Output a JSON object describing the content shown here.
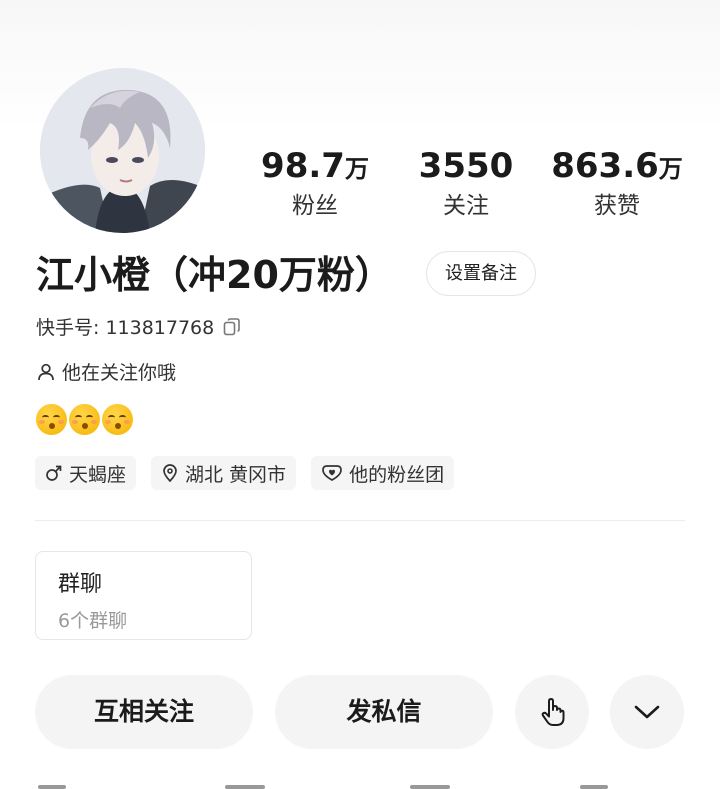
{
  "profile": {
    "name": "江小橙（冲20万粉）",
    "remark_button": "设置备注",
    "kwai_id": "快手号: 113817768",
    "follow_hint": "他在关注你哦"
  },
  "stats": {
    "fans": {
      "value": "98.7",
      "unit": "万",
      "label": "粉丝"
    },
    "following": {
      "value": "3550",
      "unit": "",
      "label": "关注"
    },
    "likes": {
      "value": "863.6",
      "unit": "万",
      "label": "获赞"
    }
  },
  "emoji": [
    "kissing-smiling-eyes",
    "kissing-smiling-eyes",
    "kissing-smiling-eyes"
  ],
  "tags": {
    "zodiac": "天蝎座",
    "location": "湖北 黄冈市",
    "fan_group": "他的粉丝团"
  },
  "group_chat": {
    "title": "群聊",
    "count": "6个群聊"
  },
  "actions": {
    "mutual_follow": "互相关注",
    "message": "发私信"
  },
  "icons": {
    "copy": "copy-icon",
    "person": "person-icon",
    "male": "male-icon",
    "location": "location-pin-icon",
    "fan_group": "heart-badge-icon",
    "poke": "hand-tap-icon",
    "more": "chevron-down-icon"
  }
}
